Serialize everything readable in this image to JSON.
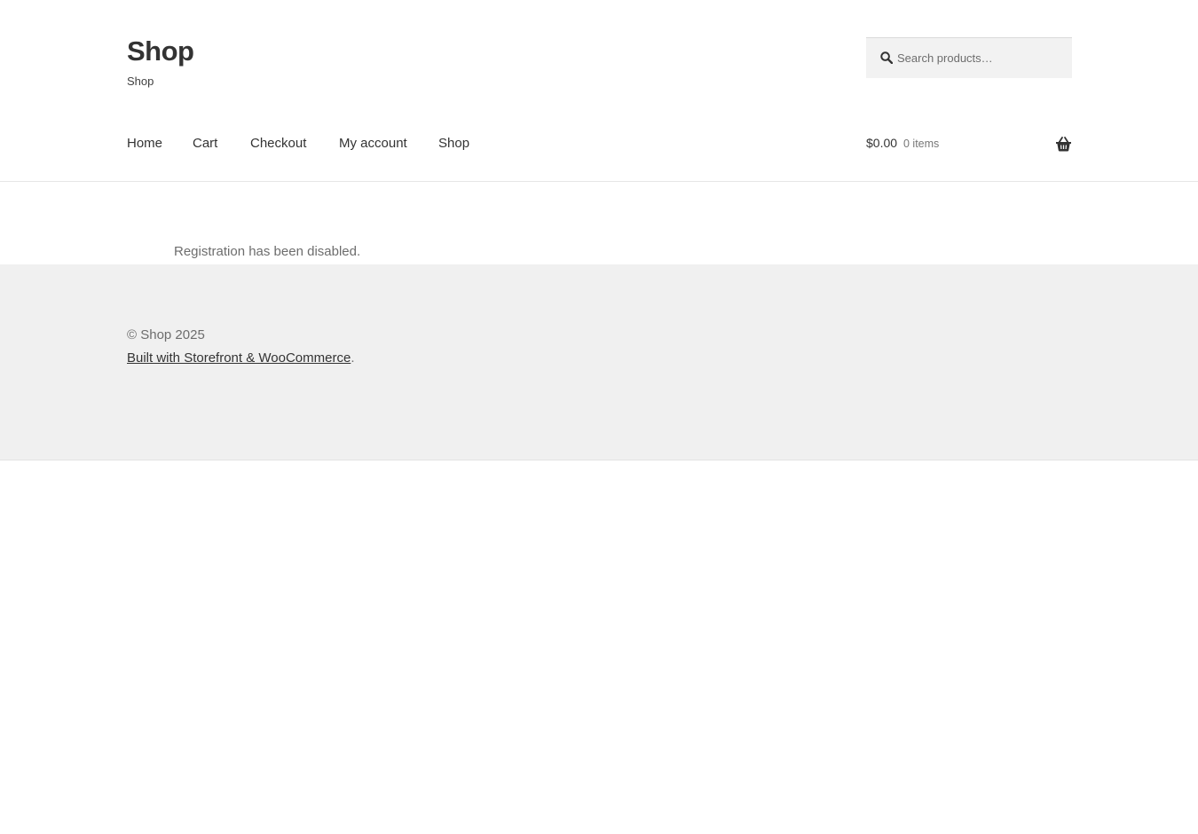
{
  "header": {
    "site_title": "Shop",
    "tagline": "Shop",
    "search": {
      "placeholder": "Search products…",
      "icon": "search-icon"
    },
    "nav": [
      {
        "label": "Home"
      },
      {
        "label": "Cart"
      },
      {
        "label": "Checkout"
      },
      {
        "label": "My account"
      },
      {
        "label": "Shop"
      }
    ],
    "cart": {
      "amount": "$0.00",
      "count": "0 items",
      "icon": "basket-icon"
    }
  },
  "main": {
    "notice": "Registration has been disabled."
  },
  "footer": {
    "copyright": "© Shop 2025",
    "credit_link": "Built with Storefront & WooCommerce",
    "credit_suffix": "."
  },
  "colors": {
    "text": "#333333",
    "muted_text": "#6d6d6d",
    "footer_bg": "#f0f0f0",
    "search_bg": "#f2f2f2"
  }
}
